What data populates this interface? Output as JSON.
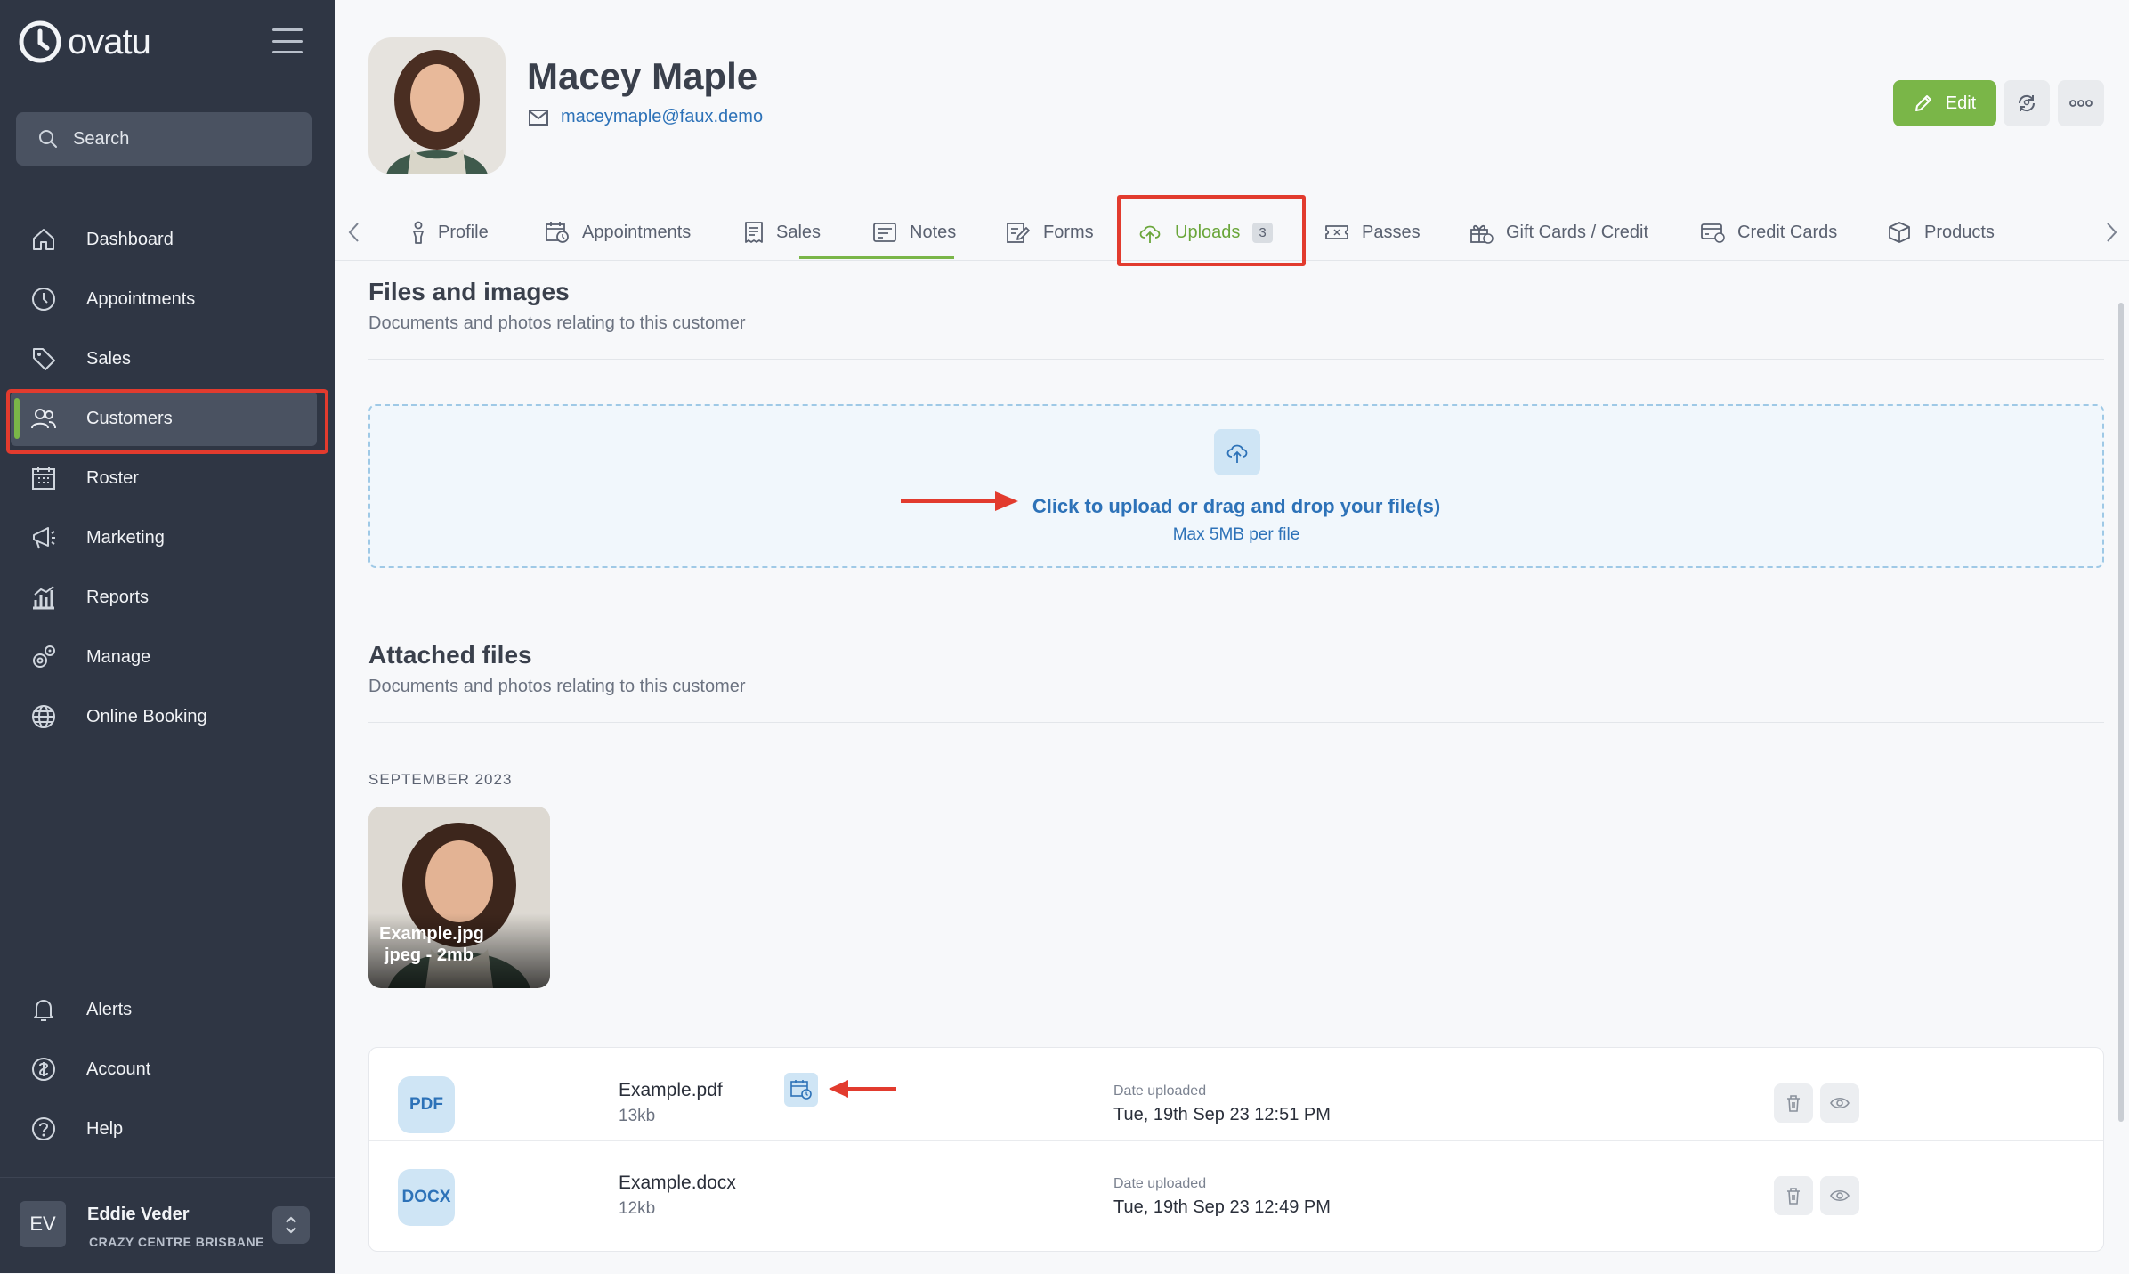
{
  "app": {
    "logo": "ovatu"
  },
  "search": {
    "label": "Search"
  },
  "nav": {
    "items": [
      {
        "label": "Dashboard",
        "icon": "home-icon"
      },
      {
        "label": "Appointments",
        "icon": "clock-icon"
      },
      {
        "label": "Sales",
        "icon": "tag-icon"
      },
      {
        "label": "Customers",
        "icon": "users-icon",
        "active": true
      },
      {
        "label": "Roster",
        "icon": "calendar-grid-icon"
      },
      {
        "label": "Marketing",
        "icon": "megaphone-icon"
      },
      {
        "label": "Reports",
        "icon": "bar-chart-icon"
      },
      {
        "label": "Manage",
        "icon": "gears-icon"
      },
      {
        "label": "Online Booking",
        "icon": "globe-icon"
      }
    ],
    "bottom": [
      {
        "label": "Alerts",
        "icon": "bell-icon"
      },
      {
        "label": "Account",
        "icon": "account-icon"
      },
      {
        "label": "Help",
        "icon": "help-icon"
      }
    ]
  },
  "user": {
    "initials": "EV",
    "name": "Eddie Veder",
    "location": "CRAZY CENTRE BRISBANE"
  },
  "customer": {
    "name": "Macey Maple",
    "email": "maceymaple@faux.demo"
  },
  "actions": {
    "edit": "Edit"
  },
  "tabs": [
    {
      "label": "Profile"
    },
    {
      "label": "Appointments"
    },
    {
      "label": "Sales"
    },
    {
      "label": "Notes"
    },
    {
      "label": "Forms"
    },
    {
      "label": "Uploads",
      "badge": "3",
      "active": true
    },
    {
      "label": "Passes"
    },
    {
      "label": "Gift Cards / Credit"
    },
    {
      "label": "Credit Cards"
    },
    {
      "label": "Products"
    }
  ],
  "files_section": {
    "title": "Files and images",
    "subtitle": "Documents and photos relating to this customer",
    "upload_main": "Click to upload or drag and drop your file(s)",
    "upload_sub": "Max 5MB per file"
  },
  "attached": {
    "title": "Attached files",
    "subtitle": "Documents and photos relating to this customer",
    "month": "SEPTEMBER 2023",
    "image": {
      "name": "Example.jpg",
      "meta": "jpeg - 2mb"
    },
    "files": [
      {
        "badge": "PDF",
        "name": "Example.pdf",
        "size": "13kb",
        "date_label": "Date uploaded",
        "date": "Tue, 19th Sep 23 12:51 PM"
      },
      {
        "badge": "DOCX",
        "name": "Example.docx",
        "size": "12kb",
        "date_label": "Date uploaded",
        "date": "Tue, 19th Sep 23 12:49 PM"
      }
    ]
  },
  "colors": {
    "sidebar": "#2f3644",
    "accent": "#7ab648",
    "link": "#2d72b8",
    "annotation": "#e23b2e"
  }
}
